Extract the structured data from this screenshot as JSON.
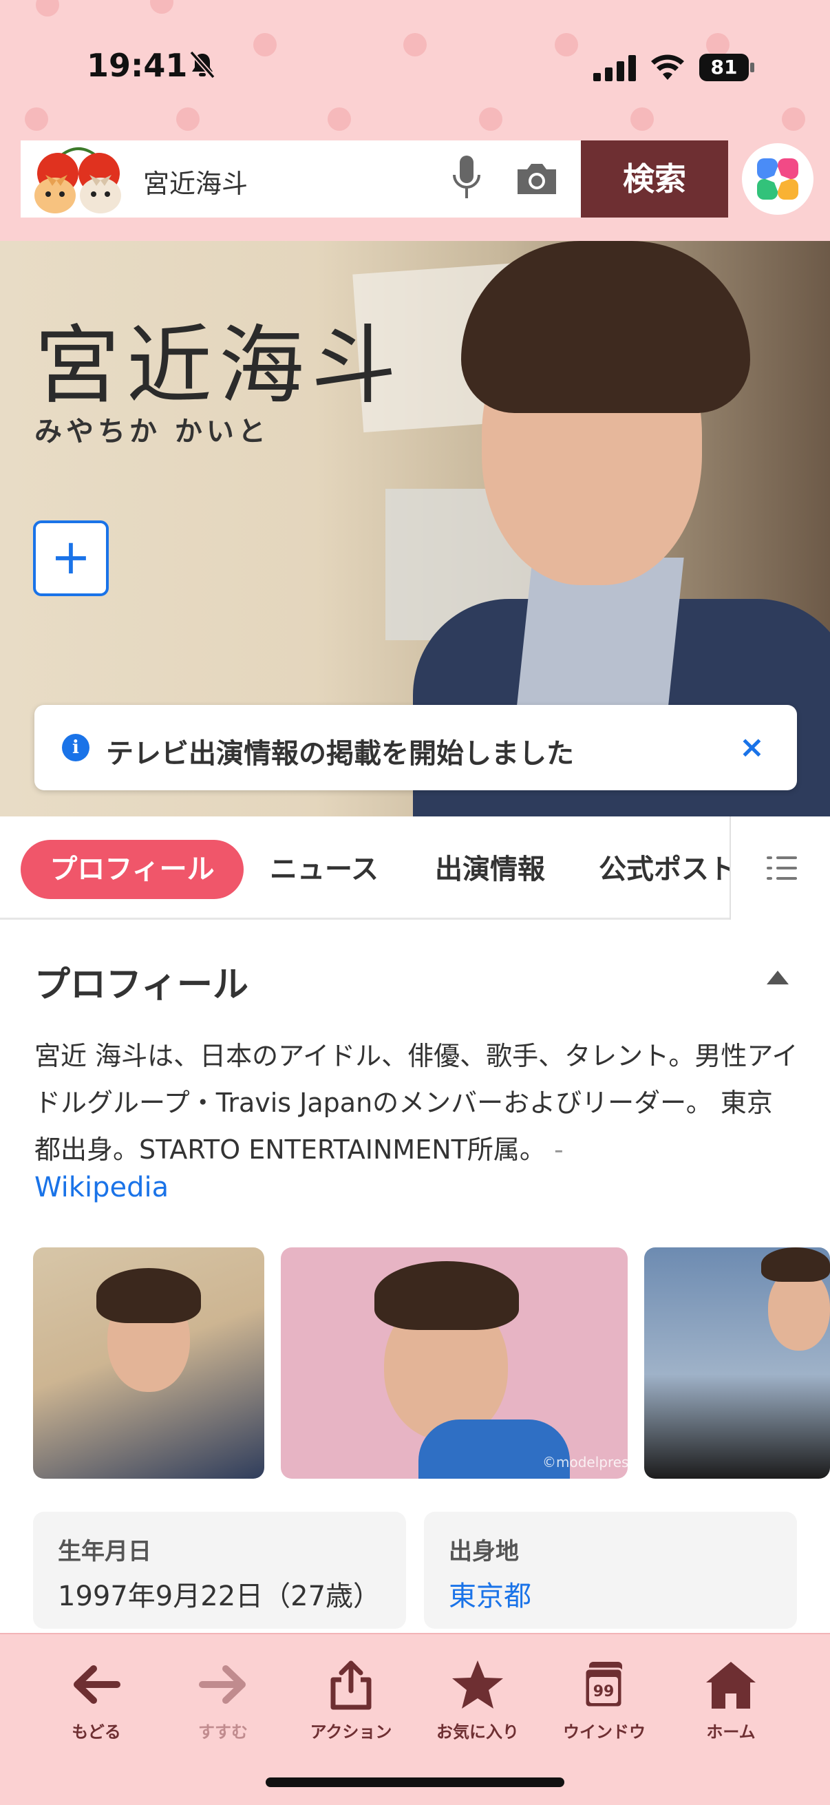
{
  "status": {
    "time": "19:41",
    "battery": "81"
  },
  "search": {
    "query": "宮近海斗",
    "button": "検索"
  },
  "hero": {
    "name": "宮近海斗",
    "kana": "みやちか かいと",
    "add_symbol": "+"
  },
  "notice": {
    "text": "テレビ出演情報の掲載を開始しました",
    "close": "×"
  },
  "tabs": [
    {
      "label": "プロフィール",
      "active": true
    },
    {
      "label": "ニュース"
    },
    {
      "label": "出演情報"
    },
    {
      "label": "公式ポスト"
    }
  ],
  "profile": {
    "title": "プロフィール",
    "description": "宮近 海斗は、日本のアイドル、俳優、歌手、タレント。男性アイドルグループ・Travis Japanのメンバーおよびリーダー。 東京都出身。STARTO ENTERTAINMENT所属。",
    "source_sep": "-",
    "source": "Wikipedia",
    "photo_watermark": "©modelpress",
    "facts": [
      {
        "label": "生年月日",
        "value": "1997年9月22日（27歳）"
      },
      {
        "label": "出身地",
        "value": "東京都"
      }
    ]
  },
  "toolbar": {
    "back": "もどる",
    "forward": "すすむ",
    "action": "アクション",
    "favorites": "お気に入り",
    "window": "ウインドウ",
    "window_count": "99",
    "home": "ホーム"
  },
  "colors": {
    "header_pink": "#fbd1d2",
    "search_button": "#6e2f32",
    "active_tab": "#f0566a",
    "link_blue": "#1a73e8"
  }
}
